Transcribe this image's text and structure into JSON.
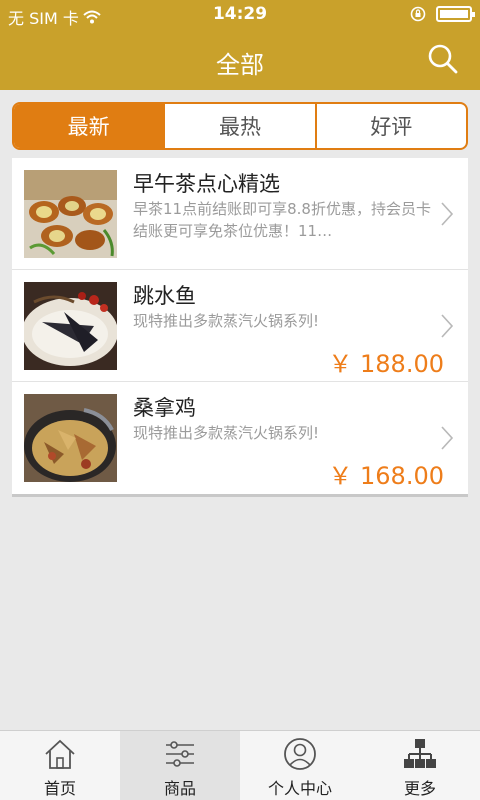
{
  "status_bar": {
    "carrier": "无 SIM 卡",
    "time": "14:29"
  },
  "header": {
    "title": "全部"
  },
  "segments": [
    {
      "label": "最新",
      "active": true
    },
    {
      "label": "最热",
      "active": false
    },
    {
      "label": "好评",
      "active": false
    }
  ],
  "items": [
    {
      "title": "早午茶点心精选",
      "desc": "早茶11点前结账即可享8.8折优惠，持会员卡结账更可享免茶位优惠！11…",
      "price": ""
    },
    {
      "title": "跳水鱼",
      "desc": "现特推出多款蒸汽火锅系列!",
      "price": "￥ 188.00"
    },
    {
      "title": "桑拿鸡",
      "desc": "现特推出多款蒸汽火锅系列!",
      "price": "￥ 168.00"
    }
  ],
  "tabs": [
    {
      "label": "首页",
      "icon": "home-icon",
      "active": false
    },
    {
      "label": "商品",
      "icon": "list-icon",
      "active": true
    },
    {
      "label": "个人中心",
      "icon": "user-icon",
      "active": false
    },
    {
      "label": "更多",
      "icon": "sitemap-icon",
      "active": false
    }
  ],
  "colors": {
    "accent": "#c9a12b",
    "segment": "#e07d12",
    "price": "#ee7d1a"
  }
}
